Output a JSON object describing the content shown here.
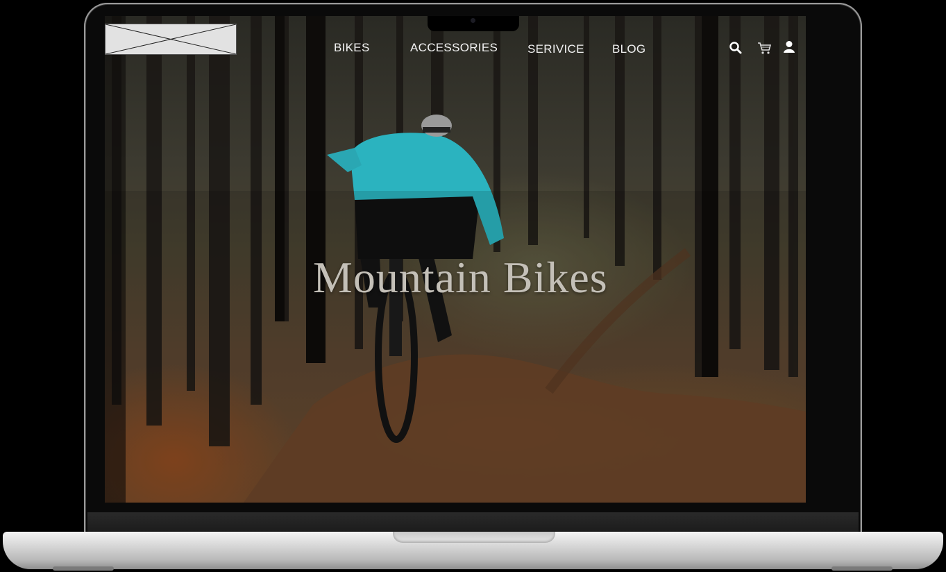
{
  "header": {
    "nav_items": [
      {
        "label": "BIKES"
      },
      {
        "label": "ACCESSORIES"
      },
      {
        "label": "SERIVICE"
      },
      {
        "label": "BLOG"
      }
    ],
    "icons": [
      "search-icon",
      "cart-icon",
      "user-icon"
    ]
  },
  "hero": {
    "title": "Mountain Bikes"
  },
  "colors": {
    "nav_text": "#f2f2f2",
    "hero_title": "#c4c0b8",
    "jacket_accent": "#2bb3bf"
  }
}
